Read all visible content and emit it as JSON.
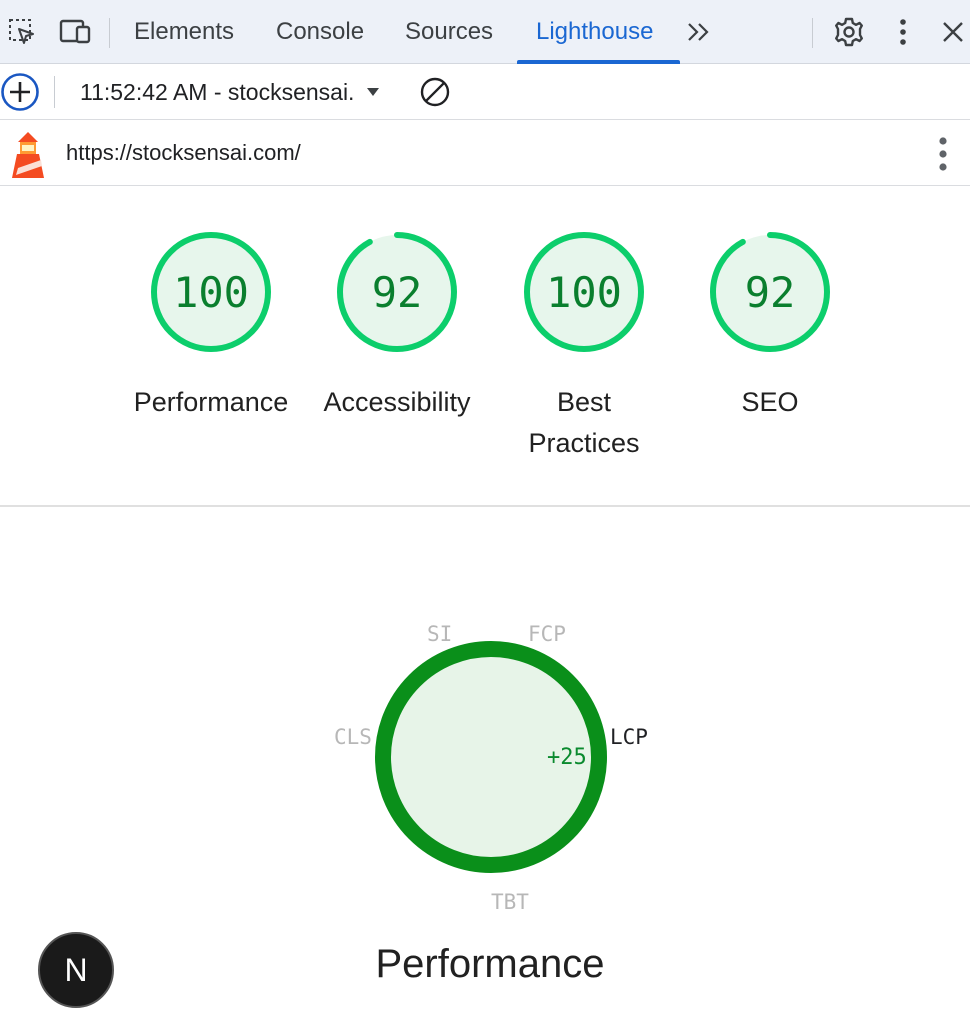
{
  "tabs": {
    "items": [
      {
        "label": "Elements"
      },
      {
        "label": "Console"
      },
      {
        "label": "Sources"
      },
      {
        "label": "Lighthouse",
        "active": true
      }
    ],
    "more_icon": "chevrons-right-icon"
  },
  "toolbar": {
    "report_label": "11:52:42 AM - stocksensai."
  },
  "urlbar": {
    "url": "https://stocksensai.com/"
  },
  "scores": [
    {
      "value": "100",
      "label": "Performance",
      "fraction": 1.0
    },
    {
      "value": "92",
      "label": "Accessibility",
      "fraction": 0.92
    },
    {
      "value": "100",
      "label_line1": "Best",
      "label_line2": "Practices",
      "fraction": 1.0
    },
    {
      "value": "92",
      "label": "SEO",
      "fraction": 0.92
    }
  ],
  "perf_gauge": {
    "metrics": {
      "si": "SI",
      "fcp": "FCP",
      "lcp": "LCP",
      "cls": "CLS",
      "tbt": "TBT"
    },
    "delta": "+25",
    "title": "Performance"
  },
  "badge": {
    "letter": "N"
  },
  "colors": {
    "pass_green": "#0cce6b",
    "score_text": "#0a7f2e",
    "accent_blue": "#1a67d2",
    "perf_ring": "#0a8f1a"
  }
}
